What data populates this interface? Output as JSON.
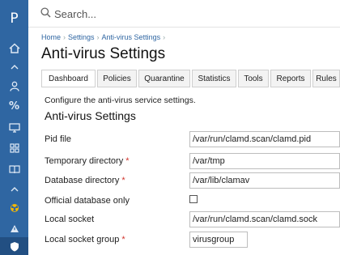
{
  "app": {
    "logo_letter": "P"
  },
  "sidebar": {
    "icons": [
      "home-icon",
      "chevron-up-icon",
      "user-icon",
      "percent-icon",
      "monitor-icon",
      "grid-icon",
      "book-icon",
      "chevron-up-icon",
      "radiation-icon",
      "alert-icon",
      "shield-icon"
    ],
    "accent": "#2f66a2"
  },
  "search": {
    "placeholder": "Search..."
  },
  "breadcrumb": {
    "items": [
      "Home",
      "Settings",
      "Anti-virus Settings"
    ]
  },
  "page": {
    "title": "Anti-virus Settings",
    "description": "Configure the anti-virus service settings.",
    "section_title": "Anti-virus Settings"
  },
  "tabs": [
    {
      "label": "Dashboard",
      "active": true
    },
    {
      "label": "Policies"
    },
    {
      "label": "Quarantine"
    },
    {
      "label": "Statistics"
    },
    {
      "label": "Tools"
    },
    {
      "label": "Reports"
    },
    {
      "label": "Rules"
    }
  ],
  "form": {
    "pid_file": {
      "label": "Pid file",
      "value": "/var/run/clamd.scan/clamd.pid"
    },
    "temp_dir": {
      "label": "Temporary directory",
      "required_mark": "*",
      "value": "/var/tmp"
    },
    "db_dir": {
      "label": "Database directory",
      "required_mark": "*",
      "value": "/var/lib/clamav"
    },
    "official_db": {
      "label": "Official database only",
      "checked": false
    },
    "local_socket": {
      "label": "Local socket",
      "value": "/var/run/clamd.scan/clamd.sock"
    },
    "socket_group": {
      "label": "Local socket group",
      "required_mark": "*",
      "value": "virusgroup"
    }
  }
}
